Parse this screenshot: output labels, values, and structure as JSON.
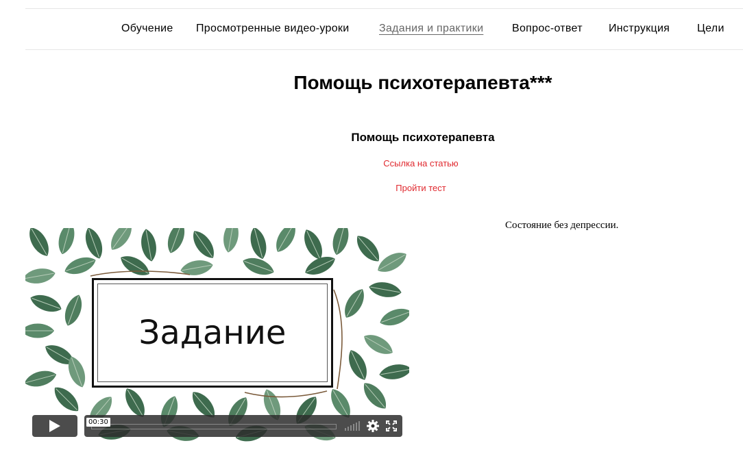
{
  "nav": {
    "items": [
      {
        "label": "Обучение"
      },
      {
        "label": "Просмотренные видео-уроки"
      },
      {
        "label": "Задания и практики"
      },
      {
        "label": "Вопрос-ответ"
      },
      {
        "label": "Инструкция"
      },
      {
        "label": "Цели"
      }
    ],
    "active_index": 2
  },
  "page": {
    "title": "Помощь психотерапевта***"
  },
  "card": {
    "title": "Помощь психотерапевта",
    "article_link": "Ссылка на статью",
    "test_link": "Пройти тест",
    "description": "Состояние без депрессии."
  },
  "video": {
    "thumbnail_text": "Задание",
    "time": "00:30",
    "icons": [
      "play-icon",
      "volume-icon",
      "gear-icon",
      "fullscreen-icon"
    ]
  },
  "colors": {
    "link_red": "#e0282e",
    "leaf_green": "#3e6b4e",
    "controls_bg": "#2d2d2d"
  }
}
